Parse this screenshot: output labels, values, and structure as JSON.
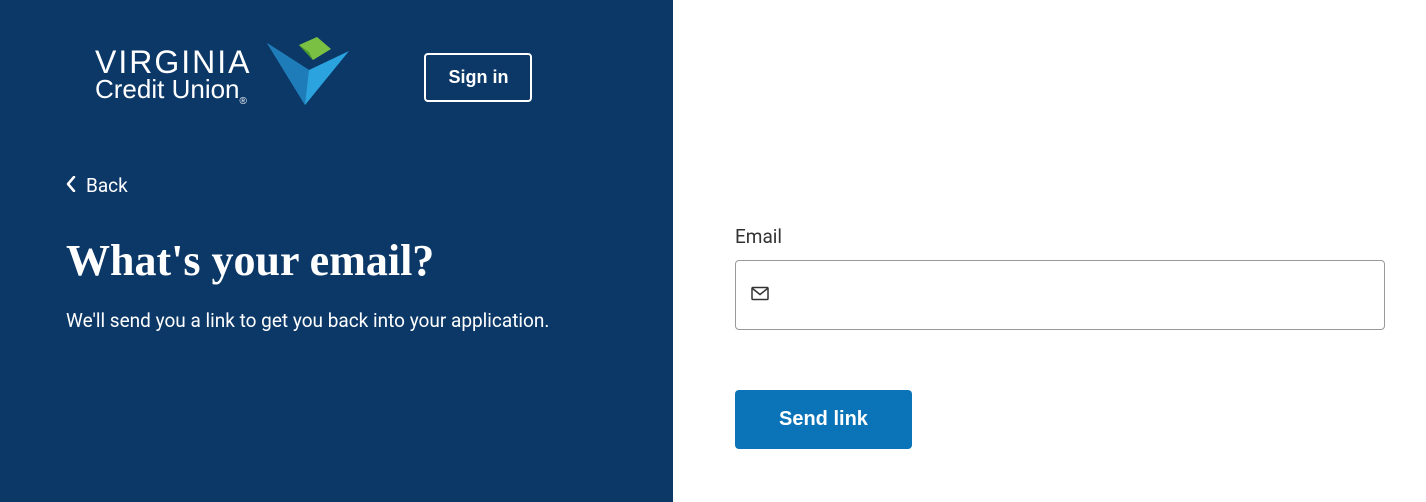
{
  "brand": {
    "line1": "VIRGINIA",
    "line2": "Credit Union",
    "accent_color": "#0c3868",
    "logo_blue": "#2aa3df",
    "logo_green": "#7ac143"
  },
  "header": {
    "signin_label": "Sign in"
  },
  "nav": {
    "back_label": "Back"
  },
  "content": {
    "heading": "What's your email?",
    "subheading": "We'll send you a link to get you back into your application."
  },
  "form": {
    "email_label": "Email",
    "email_value": "",
    "submit_label": "Send link",
    "button_color": "#0b74b8"
  }
}
